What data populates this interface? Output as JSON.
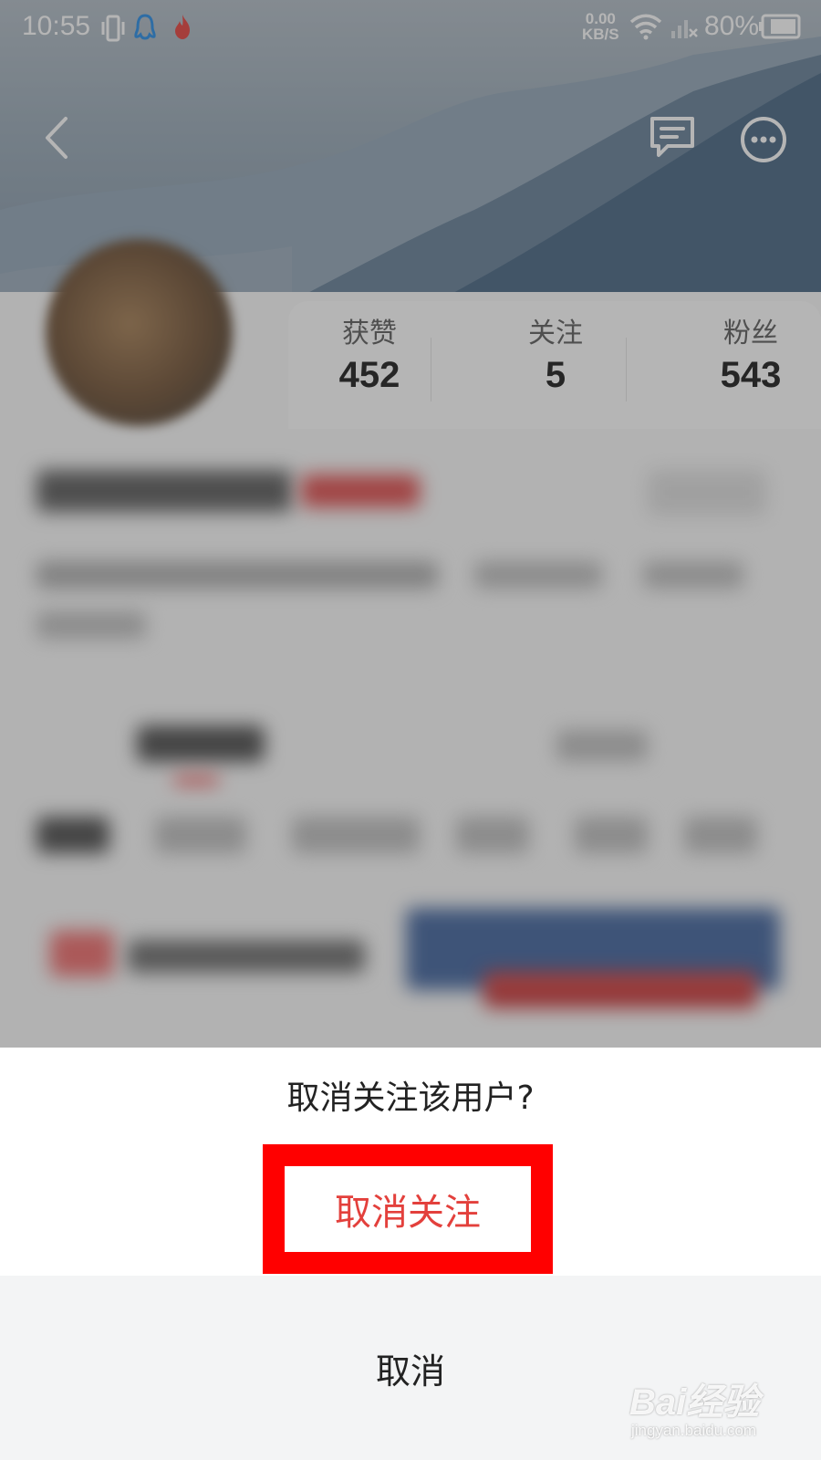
{
  "status_bar": {
    "time": "10:55",
    "net_speed_value": "0.00",
    "net_speed_unit": "KB/S",
    "battery_percent": "80%",
    "icons": [
      "vibrate-icon",
      "qq-icon",
      "flame-icon",
      "wifi-icon",
      "signal-icon",
      "battery-icon"
    ]
  },
  "header": {
    "icons": [
      "back-icon",
      "message-icon",
      "more-icon"
    ]
  },
  "profile": {
    "stats": [
      {
        "label": "获赞",
        "value": "452"
      },
      {
        "label": "关注",
        "value": "5"
      },
      {
        "label": "粉丝",
        "value": "543"
      }
    ]
  },
  "dialog": {
    "title": "取消关注该用户?",
    "confirm_label": "取消关注",
    "cancel_label": "取消",
    "confirm_color": "#e3403c",
    "highlight_color": "#ff0000"
  },
  "watermark": {
    "brand": "Bai经验",
    "url": "jingyan.baidu.com"
  }
}
